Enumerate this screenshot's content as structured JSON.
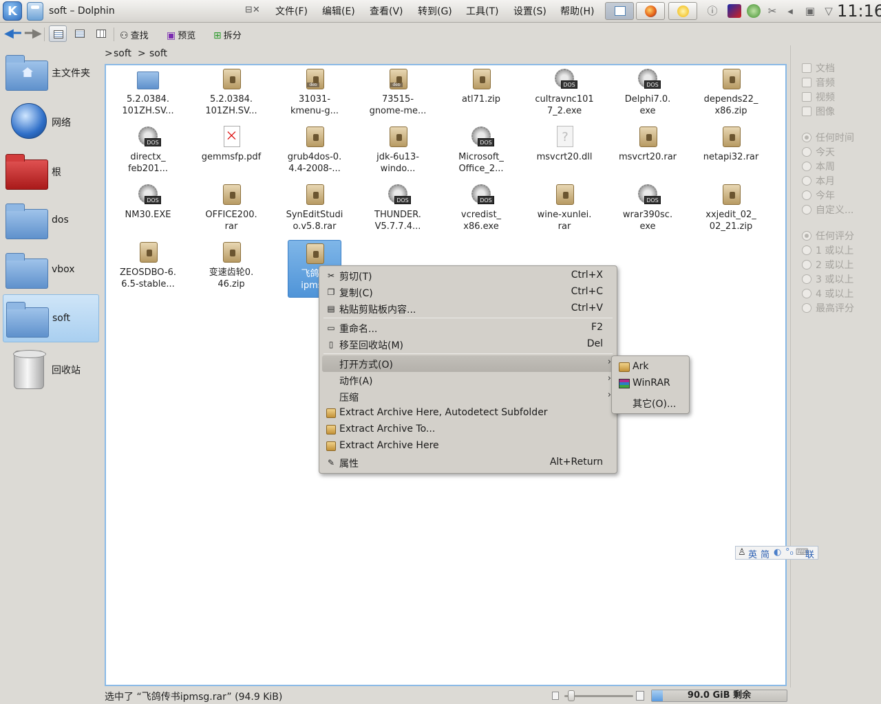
{
  "taskbar": {
    "window_title": "soft – Dolphin",
    "mode_label": "⊟✕",
    "menus": [
      "文件(F)",
      "编辑(E)",
      "查看(V)",
      "转到(G)",
      "工具(T)",
      "设置(S)",
      "帮助(H)"
    ],
    "clock": "11:16"
  },
  "toolbar": {
    "find_label": "查找",
    "preview_label": "预览",
    "split_label": "拆分"
  },
  "places": [
    {
      "label": "主文件夹",
      "icon": "home-folder-icon"
    },
    {
      "label": "网络",
      "icon": "network-globe-icon"
    },
    {
      "label": "根",
      "icon": "root-folder-icon"
    },
    {
      "label": "dos",
      "icon": "folder-icon"
    },
    {
      "label": "vbox",
      "icon": "folder-icon"
    },
    {
      "label": "soft",
      "icon": "folder-icon",
      "active": true
    },
    {
      "label": "回收站",
      "icon": "trash-icon"
    }
  ],
  "breadcrumb": {
    "sep": ">",
    "items": [
      "soft",
      "soft"
    ]
  },
  "files": [
    {
      "l1": "5.2.0384.",
      "l2": "101ZH.SV...",
      "type": "folder"
    },
    {
      "l1": "5.2.0384.",
      "l2": "101ZH.SV...",
      "type": "pkg"
    },
    {
      "l1": "31031-",
      "l2": "kmenu-g...",
      "type": "pkg",
      "tag": "deb"
    },
    {
      "l1": "73515-",
      "l2": "gnome-me...",
      "type": "pkg",
      "tag": "deb"
    },
    {
      "l1": "atl71.zip",
      "l2": "",
      "type": "pkg"
    },
    {
      "l1": "cultravnc101",
      "l2": "7_2.exe",
      "type": "exe"
    },
    {
      "l1": "Delphi7.0.",
      "l2": "exe",
      "type": "exe"
    },
    {
      "l1": "depends22_",
      "l2": "x86.zip",
      "type": "pkg"
    },
    {
      "l1": "directx_",
      "l2": "feb201...",
      "type": "exe"
    },
    {
      "l1": "gemmsfp.pdf",
      "l2": "",
      "type": "pdf"
    },
    {
      "l1": "grub4dos-0.",
      "l2": "4.4-2008-...",
      "type": "pkg"
    },
    {
      "l1": "jdk-6u13-",
      "l2": "windo...",
      "type": "pkg"
    },
    {
      "l1": "Microsoft_",
      "l2": "Office_2...",
      "type": "exe"
    },
    {
      "l1": "msvcrt20.dll",
      "l2": "",
      "type": "dll"
    },
    {
      "l1": "msvcrt20.rar",
      "l2": "",
      "type": "pkg"
    },
    {
      "l1": "netapi32.rar",
      "l2": "",
      "type": "pkg"
    },
    {
      "l1": "NM30.EXE",
      "l2": "",
      "type": "exe"
    },
    {
      "l1": "OFFICE200.",
      "l2": "rar",
      "type": "pkg"
    },
    {
      "l1": "SynEditStudi",
      "l2": "o.v5.8.rar",
      "type": "pkg"
    },
    {
      "l1": "THUNDER.",
      "l2": "V5.7.7.4...",
      "type": "exe"
    },
    {
      "l1": "vcredist_",
      "l2": "x86.exe",
      "type": "exe"
    },
    {
      "l1": "wine-xunlei.",
      "l2": "rar",
      "type": "pkg"
    },
    {
      "l1": "wrar390sc.",
      "l2": "exe",
      "type": "exe"
    },
    {
      "l1": "xxjedit_02_",
      "l2": "02_21.zip",
      "type": "pkg"
    },
    {
      "l1": "ZEOSDBO-6.",
      "l2": "6.5-stable...",
      "type": "pkg"
    },
    {
      "l1": "变速齿轮0.",
      "l2": "46.zip",
      "type": "pkg"
    },
    {
      "l1": "飞鸽传",
      "l2": "ipmsg",
      "type": "pkg",
      "selected": true
    }
  ],
  "filters": {
    "types": [
      "文档",
      "音频",
      "视频",
      "图像"
    ],
    "dates": [
      "任何时间",
      "今天",
      "本周",
      "本月",
      "今年",
      "自定义..."
    ],
    "ratings": [
      "任何评分",
      "1 或以上",
      "2 或以上",
      "3 或以上",
      "4 或以上",
      "最高评分"
    ]
  },
  "context_menu": [
    {
      "label": "剪切(T)",
      "shortcut": "Ctrl+X",
      "icon": "scissors-icon"
    },
    {
      "label": "复制(C)",
      "shortcut": "Ctrl+C",
      "icon": "copy-icon"
    },
    {
      "label": "粘贴剪贴板内容...",
      "shortcut": "Ctrl+V",
      "icon": "paste-icon"
    },
    {
      "label": "重命名...",
      "shortcut": "F2",
      "icon": "rename-icon"
    },
    {
      "label": "移至回收站(M)",
      "shortcut": "Del",
      "icon": "trash-icon"
    },
    {
      "label": "打开方式(O)",
      "shortcut": "",
      "icon": "",
      "submenu": true,
      "highlight": true
    },
    {
      "label": "动作(A)",
      "shortcut": "",
      "icon": "",
      "submenu": true
    },
    {
      "label": "压缩",
      "shortcut": "",
      "icon": "",
      "submenu": true
    },
    {
      "label": "Extract Archive Here, Autodetect Subfolder",
      "shortcut": "",
      "icon": "archive-icon"
    },
    {
      "label": "Extract Archive To...",
      "shortcut": "",
      "icon": "archive-icon"
    },
    {
      "label": "Extract Archive Here",
      "shortcut": "",
      "icon": "archive-icon"
    },
    {
      "label": "属性",
      "shortcut": "Alt+Return",
      "icon": "properties-icon"
    }
  ],
  "submenu": [
    {
      "label": "Ark",
      "icon": "ark-icon"
    },
    {
      "label": "WinRAR",
      "icon": "winrar-icon"
    },
    {
      "label": "其它(O)...",
      "icon": ""
    }
  ],
  "status": {
    "text": "选中了 “飞鸽传书ipmsg.rar” (94.9 KiB)",
    "free_space": "90.0 GiB 剩余",
    "free_fraction": 0.08
  },
  "ime": {
    "labels": [
      "英",
      "简",
      "联"
    ]
  }
}
